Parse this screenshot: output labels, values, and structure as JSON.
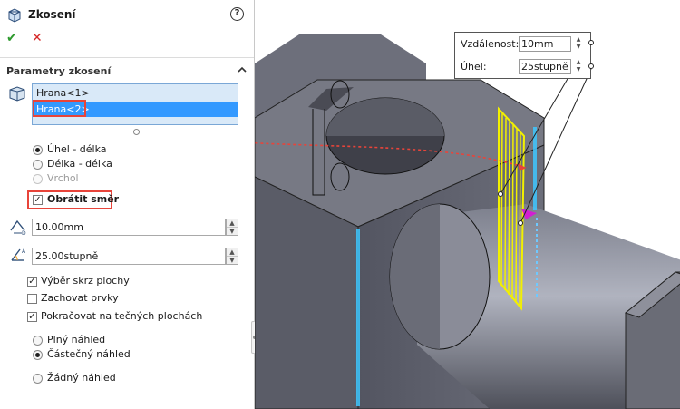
{
  "panel": {
    "title": "Zkosení",
    "help_symbol": "?",
    "ok_symbol": "✔",
    "cancel_symbol": "✕",
    "section_title": "Parametry zkosení",
    "edges": [
      "Hrana<1>",
      "Hrana<2>"
    ],
    "type_options": [
      {
        "label": "Úhel - délka",
        "checked": true,
        "enabled": true
      },
      {
        "label": "Délka - délka",
        "checked": false,
        "enabled": true
      },
      {
        "label": "Vrchol",
        "checked": false,
        "enabled": false
      }
    ],
    "flip_label": "Obrátit směr",
    "flip_checked": true,
    "distance_value": "10.00mm",
    "angle_value": "25.00stupně",
    "options": [
      {
        "label": "Výběr skrz plochy",
        "checked": true
      },
      {
        "label": "Zachovat prvky",
        "checked": false
      },
      {
        "label": "Pokračovat na tečných plochách",
        "checked": true
      }
    ],
    "preview_options": [
      {
        "label": "Plný náhled",
        "checked": false
      },
      {
        "label": "Částečný náhled",
        "checked": true
      },
      {
        "label": "Žádný náhled",
        "checked": false
      }
    ]
  },
  "callout": {
    "distance_label": "Vzdálenost:",
    "distance_value": "10mm",
    "angle_label": "Úhel:",
    "angle_value": "25stupně"
  },
  "colors": {
    "accent_green": "#2e9a2e",
    "cancel_red": "#d62828",
    "highlight_red": "#e8443a",
    "selection_blue": "#3399ff",
    "edge_glow": "#3fc7ff",
    "preview_yellow": "#f2f000",
    "part_gray": "#5d5f6a"
  },
  "icons": [
    "chamfer-feature-icon",
    "help-icon",
    "ok-check-icon",
    "cancel-x-icon",
    "collapse-chevron-icon",
    "edge-selection-icon",
    "distance-icon",
    "angle-icon"
  ]
}
